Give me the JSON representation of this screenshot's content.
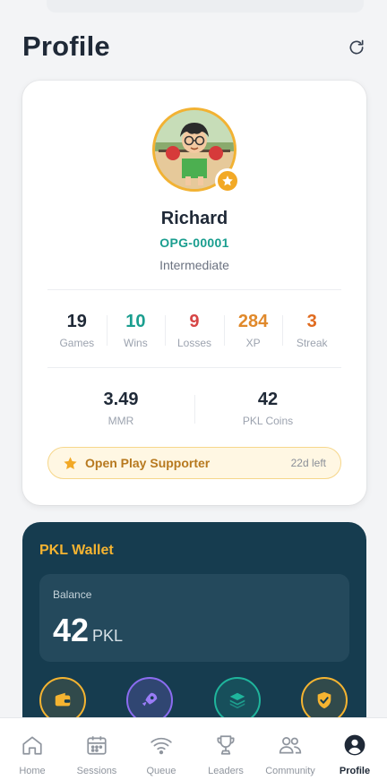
{
  "header": {
    "title": "Profile",
    "refresh_icon": "refresh-icon"
  },
  "profile": {
    "name": "Richard",
    "player_id": "OPG-00001",
    "level": "Intermediate",
    "avatar_badge_icon": "star-icon",
    "stats": [
      {
        "key": "games",
        "value": "19",
        "label": "Games",
        "color": "#1f2937"
      },
      {
        "key": "wins",
        "value": "10",
        "label": "Wins",
        "color": "#1a9e8f"
      },
      {
        "key": "losses",
        "value": "9",
        "label": "Losses",
        "color": "#d64545"
      },
      {
        "key": "xp",
        "value": "284",
        "label": "XP",
        "color": "#e0892b"
      },
      {
        "key": "streak",
        "value": "3",
        "label": "Streak",
        "color": "#e06b1f"
      }
    ],
    "secondary": [
      {
        "key": "mmr",
        "value": "3.49",
        "label": "MMR"
      },
      {
        "key": "pkl_coins",
        "value": "42",
        "label": "PKL Coins"
      }
    ],
    "supporter": {
      "label": "Open Play Supporter",
      "time_left": "22d left",
      "icon": "star-icon"
    }
  },
  "wallet": {
    "title": "PKL Wallet",
    "balance_label": "Balance",
    "balance_value": "42",
    "balance_unit": "PKL",
    "actions": [
      {
        "icon": "wallet-icon",
        "color": "#f5b431"
      },
      {
        "icon": "rocket-icon",
        "color": "#8b6cf0"
      },
      {
        "icon": "layers-icon",
        "color": "#1fb59c"
      },
      {
        "icon": "shield-check-icon",
        "color": "#f5b431"
      }
    ]
  },
  "nav": {
    "items": [
      {
        "label": "Home",
        "icon": "home-icon"
      },
      {
        "label": "Sessions",
        "icon": "calendar-icon"
      },
      {
        "label": "Queue",
        "icon": "wifi-icon"
      },
      {
        "label": "Leaders",
        "icon": "trophy-icon"
      },
      {
        "label": "Community",
        "icon": "users-icon"
      },
      {
        "label": "Profile",
        "icon": "user-circle-icon",
        "active": true
      }
    ]
  }
}
